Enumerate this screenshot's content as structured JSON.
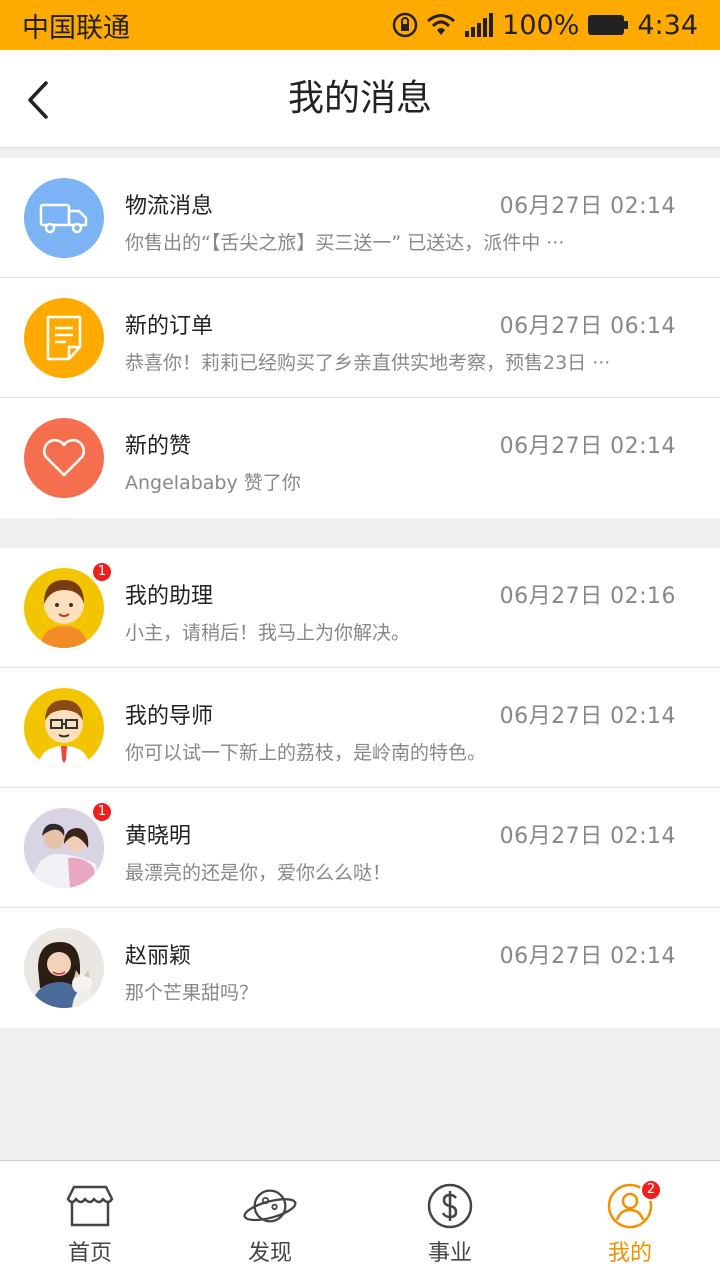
{
  "status_bar": {
    "carrier": "中国联通",
    "battery": "100%",
    "time": "4:34"
  },
  "header": {
    "title": "我的消息"
  },
  "system_messages": [
    {
      "icon": "truck-icon",
      "color": "#7bb3f5",
      "title": "物流消息",
      "time": "06月27日 02:14",
      "preview": "你售出的“【舌尖之旅】买三送一” 已送达，派件中 ···"
    },
    {
      "icon": "document-icon",
      "color": "#ffaa00",
      "title": "新的订单",
      "time": "06月27日 06:14",
      "preview": "恭喜你！莉莉已经购买了乡亲直供实地考察，预售23日 ···"
    },
    {
      "icon": "heart-icon",
      "color": "#f56f4f",
      "title": "新的赞",
      "time": "06月27日 02:14",
      "preview": "Angelababy   赞了你"
    }
  ],
  "chats": [
    {
      "avatar": "assistant-avatar",
      "title": "我的助理",
      "time": "06月27日 02:16",
      "preview": "小主，请稍后！我马上为你解决。",
      "unread": "1"
    },
    {
      "avatar": "mentor-avatar",
      "title": "我的导师",
      "time": "06月27日 02:14",
      "preview": "你可以试一下新上的荔枝，是岭南的特色。",
      "unread": ""
    },
    {
      "avatar": "photo-avatar",
      "title": "黄晓明",
      "time": "06月27日 02:14",
      "preview": "最漂亮的还是你，爱你么么哒！",
      "unread": "1"
    },
    {
      "avatar": "photo-avatar",
      "title": "赵丽颖",
      "time": "06月27日 02:14",
      "preview": "那个芒果甜吗？",
      "unread": ""
    }
  ],
  "bottom_nav": {
    "items": [
      {
        "label": "首页",
        "icon": "shop-icon"
      },
      {
        "label": "发现",
        "icon": "planet-icon"
      },
      {
        "label": "事业",
        "icon": "dollar-icon"
      },
      {
        "label": "我的",
        "icon": "user-icon",
        "badge": "2",
        "active": true
      }
    ]
  },
  "colors": {
    "accent": "#ffaa00",
    "active_nav": "#f39000",
    "badge": "#f01e1e"
  }
}
